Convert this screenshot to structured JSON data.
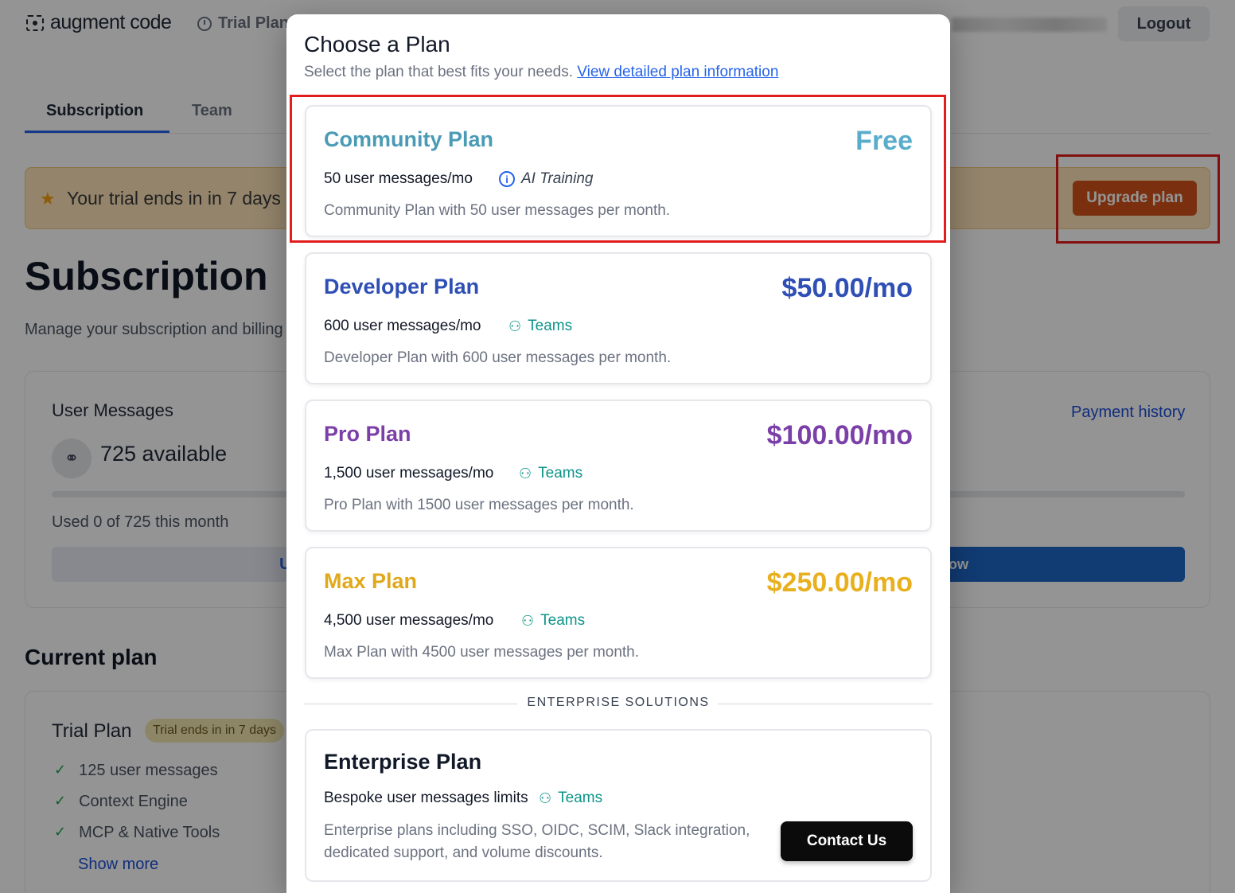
{
  "app": {
    "logo_text": "augment code",
    "trial_chip": "Trial Plan",
    "logout_label": "Logout"
  },
  "tabs": [
    {
      "label": "Subscription",
      "active": true
    },
    {
      "label": "Team",
      "active": false
    }
  ],
  "banner": {
    "text": "Your trial ends in in 7 days",
    "button_label": "Upgrade plan",
    "star_icon": "star-icon",
    "color": "#fde3b8",
    "button_color": "#d2541a"
  },
  "page": {
    "title": "Subscription",
    "subtitle": "Manage your subscription and billing"
  },
  "usage": {
    "title": "User Messages",
    "available": "725 available",
    "used_text": "Used 0 of 725 this month",
    "upgrade_label": "Upgrade plan",
    "secondary_label": "ow",
    "payment_history": "Payment history",
    "used_fraction": 0
  },
  "current_plan": {
    "section_title": "Current plan",
    "name": "Trial Plan",
    "badge": "Trial ends in in 7 days",
    "features": [
      "125 user messages",
      "Context Engine",
      "MCP & Native Tools"
    ],
    "show_more": "Show more"
  },
  "modal": {
    "title": "Choose a Plan",
    "subtitle": "Select the plan that best fits your needs.",
    "link": "View detailed plan information",
    "plans": [
      {
        "name": "Community Plan",
        "price": "Free",
        "messages": "50 user messages/mo",
        "tag": "AI Training",
        "tag_icon": "info-icon",
        "description": "Community Plan with 50 user messages per month.",
        "color": "#4a9bb5"
      },
      {
        "name": "Developer Plan",
        "price": "$50.00/mo",
        "messages": "600 user messages/mo",
        "tag": "Teams",
        "tag_icon": "add-user-icon",
        "description": "Developer Plan with 600 user messages per month.",
        "color": "#2f4fb5"
      },
      {
        "name": "Pro Plan",
        "price": "$100.00/mo",
        "messages": "1,500 user messages/mo",
        "tag": "Teams",
        "tag_icon": "add-user-icon",
        "description": "Pro Plan with 1500 user messages per month.",
        "color": "#7b3fa8"
      },
      {
        "name": "Max Plan",
        "price": "$250.00/mo",
        "messages": "4,500 user messages/mo",
        "tag": "Teams",
        "tag_icon": "add-user-icon",
        "description": "Max Plan with 4500 user messages per month.",
        "color": "#e0a91b"
      }
    ],
    "enterprise_label": "ENTERPRISE SOLUTIONS",
    "enterprise": {
      "name": "Enterprise Plan",
      "messages": "Bespoke user messages limits",
      "tag": "Teams",
      "description": "Enterprise plans including SSO, OIDC, SCIM, Slack integration, dedicated support, and volume discounts.",
      "button_label": "Contact Us"
    },
    "teams_color": "#0d9488"
  }
}
